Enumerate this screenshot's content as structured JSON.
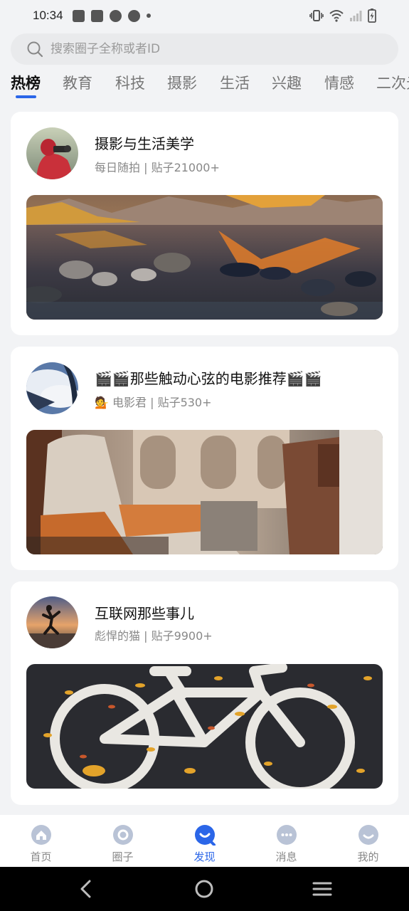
{
  "status_bar": {
    "time": "10:34"
  },
  "search": {
    "placeholder": "搜索圈子全称或者ID"
  },
  "tabs": [
    {
      "label": "热榜",
      "active": true
    },
    {
      "label": "教育"
    },
    {
      "label": "科技"
    },
    {
      "label": "摄影"
    },
    {
      "label": "生活"
    },
    {
      "label": "兴趣"
    },
    {
      "label": "情感"
    },
    {
      "label": "二次元"
    }
  ],
  "cards": [
    {
      "title": "摄影与生活美学",
      "subtitle": "每日随拍 | 贴子21000+",
      "avatar_icon": "photographer-avatar",
      "image_icon": "mountain-lake-photo"
    },
    {
      "title": "🎬🎬那些触动心弦的电影推荐🎬🎬",
      "subtitle": "💁 电影君 | 贴子530+",
      "avatar_icon": "airplane-window-avatar",
      "image_icon": "airplane-cabin-photo"
    },
    {
      "title": "互联网那些事儿",
      "subtitle": "彪悍的猫 | 贴子9900+",
      "avatar_icon": "jumping-cat-avatar",
      "image_icon": "bike-lane-photo"
    }
  ],
  "bottom_nav": [
    {
      "label": "首页",
      "icon": "home-icon"
    },
    {
      "label": "圈子",
      "icon": "circle-icon"
    },
    {
      "label": "发现",
      "icon": "discover-icon",
      "active": true
    },
    {
      "label": "消息",
      "icon": "message-icon"
    },
    {
      "label": "我的",
      "icon": "profile-icon"
    }
  ],
  "colors": {
    "accent": "#2b66e8",
    "inactive_icon": "#b9c3d6",
    "background": "#f2f3f5"
  }
}
